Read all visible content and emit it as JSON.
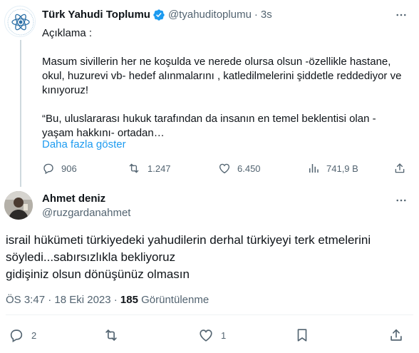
{
  "parent_tweet": {
    "author_name": "Türk Yahudi Toplumu",
    "author_handle": "@tyahuditoplumu",
    "separator": "·",
    "time": "3s",
    "paragraphs": [
      "Açıklama :",
      "Masum sivillerin her ne koşulda ve nerede olursa olsun -özellikle hastane, okul, huzurevi vb- hedef alınmalarını , katledilmelerini şiddetle reddediyor ve kınıyoruz!",
      "“Bu, uluslararası hukuk tarafından da insanın en temel beklentisi olan -yaşam hakkını- ortadan…"
    ],
    "show_more": "Daha fazla göster",
    "stats": {
      "replies": "906",
      "retweets": "1.247",
      "likes": "6.450",
      "views": "741,9 B"
    }
  },
  "main_tweet": {
    "author_name": "Ahmet deniz",
    "author_handle": "@ruzgardanahmet",
    "text": "israil hükümeti türkiyedeki yahudilerin derhal türkiyeyi terk etmelerini söyledi...sabırsızlıkla bekliyoruz\ngidişiniz olsun dönüşünüz olmasın",
    "timestamp": "ÖS 3:47 · 18 Eki 2023 · ",
    "view_count": "185",
    "view_label": " Görüntülenme",
    "stats": {
      "replies": "2",
      "retweets": "",
      "likes": "1"
    }
  },
  "icons": {
    "verified": "verified-badge-icon",
    "more": "more-dots-icon",
    "reply": "reply-icon",
    "retweet": "retweet-icon",
    "like": "like-icon",
    "views": "views-icon",
    "share": "share-icon",
    "bookmark": "bookmark-icon"
  },
  "colors": {
    "accent": "#1d9bf0",
    "muted": "#536471",
    "text": "#0f1419",
    "line": "#cfd9de"
  }
}
